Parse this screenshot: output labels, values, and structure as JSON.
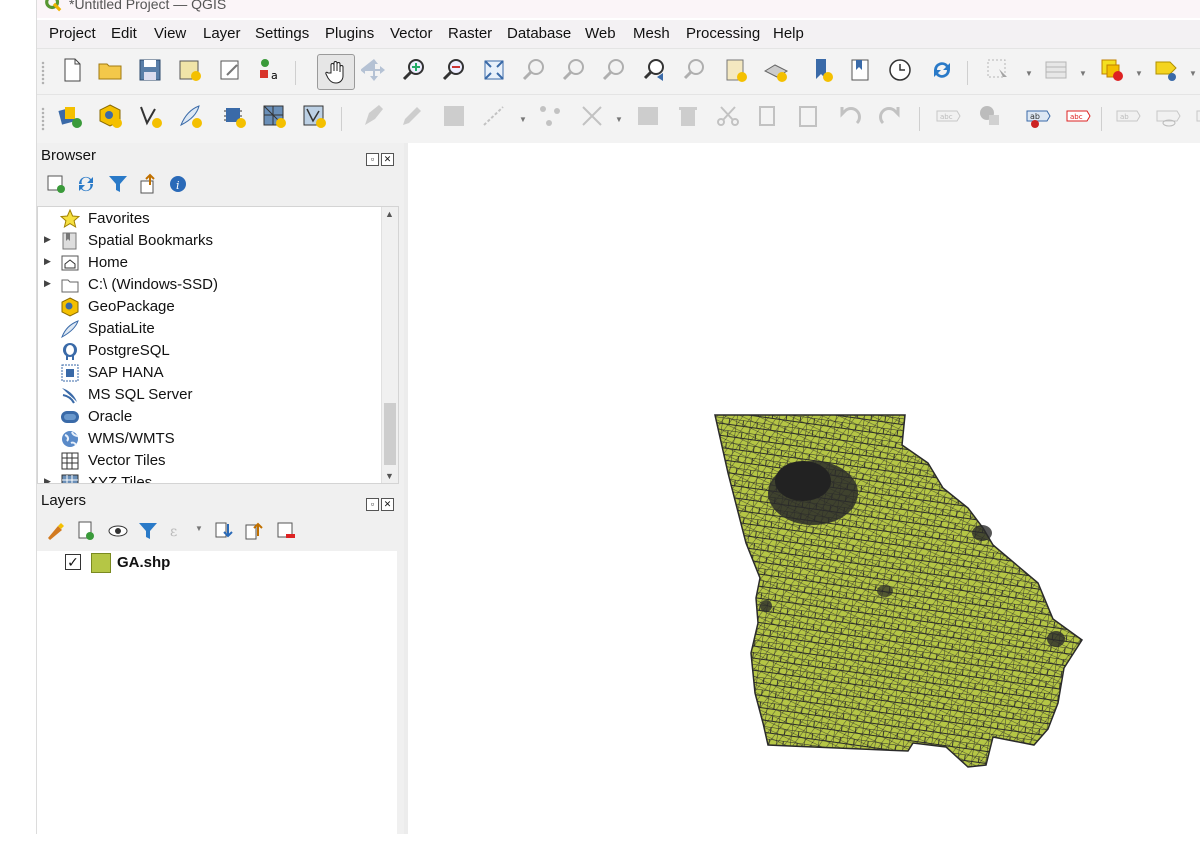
{
  "window": {
    "title": "*Untitled Project — QGIS"
  },
  "menu": [
    "Project",
    "Edit",
    "View",
    "Layer",
    "Settings",
    "Plugins",
    "Vector",
    "Raster",
    "Database",
    "Web",
    "Mesh",
    "Processing",
    "Help"
  ],
  "browser": {
    "title": "Browser",
    "items": [
      {
        "label": "Favorites",
        "icon": "star-icon",
        "expandable": false
      },
      {
        "label": "Spatial Bookmarks",
        "icon": "bookmark-icon",
        "expandable": true
      },
      {
        "label": "Home",
        "icon": "home-icon",
        "expandable": true
      },
      {
        "label": "C:\\ (Windows-SSD)",
        "icon": "folder-icon",
        "expandable": true
      },
      {
        "label": "GeoPackage",
        "icon": "geopackage-icon",
        "expandable": false
      },
      {
        "label": "SpatiaLite",
        "icon": "spatialite-icon",
        "expandable": false
      },
      {
        "label": "PostgreSQL",
        "icon": "postgresql-icon",
        "expandable": false
      },
      {
        "label": "SAP HANA",
        "icon": "sap-hana-icon",
        "expandable": false
      },
      {
        "label": "MS SQL Server",
        "icon": "mssql-icon",
        "expandable": false
      },
      {
        "label": "Oracle",
        "icon": "oracle-icon",
        "expandable": false
      },
      {
        "label": "WMS/WMTS",
        "icon": "globe-icon",
        "expandable": false
      },
      {
        "label": "Vector Tiles",
        "icon": "vector-tiles-icon",
        "expandable": false
      },
      {
        "label": "XYZ Tiles",
        "icon": "xyz-tiles-icon",
        "expandable": true
      }
    ]
  },
  "layers": {
    "title": "Layers",
    "items": [
      {
        "label": "GA.shp",
        "checked": true,
        "color": "#b5c645"
      }
    ]
  },
  "colors": {
    "fill": "#b5c645",
    "outline": "#2a2a2a",
    "qgis_green": "#589632"
  }
}
